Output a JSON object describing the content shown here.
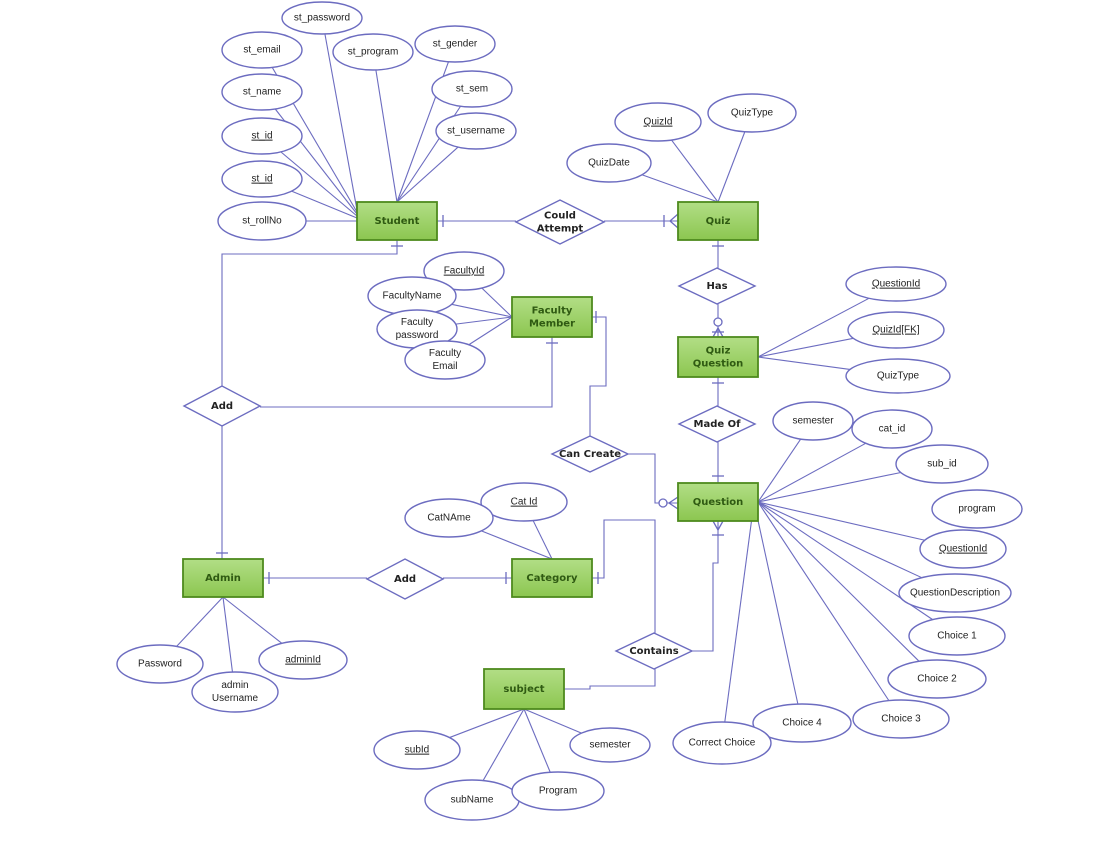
{
  "diagram": {
    "type": "entity-relationship",
    "colors": {
      "entity_fill_top": "#b2de86",
      "entity_fill_bottom": "#8cc650",
      "entity_border": "#4e8a1e",
      "entity_text": "#2f5a12",
      "line": "#6c6cc0"
    },
    "entities": [
      {
        "id": "student",
        "label": "Student"
      },
      {
        "id": "quiz",
        "label": "Quiz"
      },
      {
        "id": "faculty",
        "label": "Faculty Member"
      },
      {
        "id": "quizq",
        "label": "Quiz Question"
      },
      {
        "id": "question",
        "label": "Question"
      },
      {
        "id": "admin",
        "label": "Admin"
      },
      {
        "id": "category",
        "label": "Category"
      },
      {
        "id": "subject",
        "label": "subject"
      }
    ],
    "relationships": [
      {
        "id": "could",
        "label": "Could Attempt",
        "connects": [
          "Student",
          "Quiz"
        ]
      },
      {
        "id": "has",
        "label": "Has",
        "connects": [
          "Quiz",
          "Quiz Question"
        ]
      },
      {
        "id": "madeof",
        "label": "Made Of",
        "connects": [
          "Quiz Question",
          "Question"
        ]
      },
      {
        "id": "cancreate",
        "label": "Can Create",
        "connects": [
          "Faculty Member",
          "Question"
        ]
      },
      {
        "id": "add1",
        "label": "Add",
        "connects": [
          "Student",
          "Faculty Member",
          "Admin"
        ]
      },
      {
        "id": "add2",
        "label": "Add",
        "connects": [
          "Admin",
          "Category"
        ]
      },
      {
        "id": "contains",
        "label": "Contains",
        "connects": [
          "Category",
          "subject",
          "Question"
        ]
      }
    ],
    "attributes": [
      {
        "id": "a1",
        "label": "st_password",
        "key": false,
        "entity": "Student"
      },
      {
        "id": "a2",
        "label": "st_email",
        "key": false,
        "entity": "Student"
      },
      {
        "id": "a3",
        "label": "st_program",
        "key": false,
        "entity": "Student"
      },
      {
        "id": "a4",
        "label": "st_gender",
        "key": false,
        "entity": "Student"
      },
      {
        "id": "a5",
        "label": "st_name",
        "key": false,
        "entity": "Student"
      },
      {
        "id": "a6",
        "label": "st_sem",
        "key": false,
        "entity": "Student"
      },
      {
        "id": "a7",
        "label": "st_username",
        "key": false,
        "entity": "Student"
      },
      {
        "id": "a8",
        "label": "st_id",
        "key": true,
        "entity": "Student"
      },
      {
        "id": "a9",
        "label": "st_id",
        "key": true,
        "entity": "Student"
      },
      {
        "id": "a10",
        "label": "st_rollNo",
        "key": false,
        "entity": "Student"
      },
      {
        "id": "a11",
        "label": "QuizId",
        "key": true,
        "entity": "Quiz"
      },
      {
        "id": "a12",
        "label": "QuizType",
        "key": false,
        "entity": "Quiz"
      },
      {
        "id": "a13",
        "label": "QuizDate",
        "key": false,
        "entity": "Quiz"
      },
      {
        "id": "a14",
        "label": "FacultyId",
        "key": true,
        "entity": "Faculty Member"
      },
      {
        "id": "a15",
        "label": "FacultyName",
        "key": false,
        "entity": "Faculty Member"
      },
      {
        "id": "a16",
        "label": "Faculty password",
        "key": false,
        "entity": "Faculty Member"
      },
      {
        "id": "a17",
        "label": "Faculty Email",
        "key": false,
        "entity": "Faculty Member"
      },
      {
        "id": "a18",
        "label": "QuestionId",
        "key": true,
        "entity": "Quiz Question"
      },
      {
        "id": "a19",
        "label": "QuizId[FK]",
        "key": true,
        "entity": "Quiz Question"
      },
      {
        "id": "a20",
        "label": "QuizType",
        "key": false,
        "entity": "Quiz Question"
      },
      {
        "id": "a21",
        "label": "semester",
        "key": false,
        "entity": "Question"
      },
      {
        "id": "a22",
        "label": "cat_id",
        "key": false,
        "entity": "Question"
      },
      {
        "id": "a23",
        "label": "sub_id",
        "key": false,
        "entity": "Question"
      },
      {
        "id": "a24",
        "label": "program",
        "key": false,
        "entity": "Question"
      },
      {
        "id": "a25",
        "label": "QuestionId",
        "key": true,
        "entity": "Question"
      },
      {
        "id": "a26",
        "label": "QuestionDescription",
        "key": false,
        "entity": "Question"
      },
      {
        "id": "a27",
        "label": "Choice 1",
        "key": false,
        "entity": "Question"
      },
      {
        "id": "a28",
        "label": "Choice 2",
        "key": false,
        "entity": "Question"
      },
      {
        "id": "a29",
        "label": "Choice 3",
        "key": false,
        "entity": "Question"
      },
      {
        "id": "a30",
        "label": "Choice 4",
        "key": false,
        "entity": "Question"
      },
      {
        "id": "a31",
        "label": "Correct Choice",
        "key": false,
        "entity": "Question"
      },
      {
        "id": "a32",
        "label": "Cat Id",
        "key": true,
        "entity": "Category"
      },
      {
        "id": "a33",
        "label": "CatNAme",
        "key": false,
        "entity": "Category"
      },
      {
        "id": "a34",
        "label": "Password",
        "key": false,
        "entity": "Admin"
      },
      {
        "id": "a35",
        "label": "admin Username",
        "key": false,
        "entity": "Admin"
      },
      {
        "id": "a36",
        "label": "adminId",
        "key": true,
        "entity": "Admin"
      },
      {
        "id": "a37",
        "label": "subId",
        "key": true,
        "entity": "subject"
      },
      {
        "id": "a38",
        "label": "subName",
        "key": false,
        "entity": "subject"
      },
      {
        "id": "a39",
        "label": "Program",
        "key": false,
        "entity": "subject"
      },
      {
        "id": "a40",
        "label": "semester",
        "key": false,
        "entity": "subject"
      }
    ]
  }
}
